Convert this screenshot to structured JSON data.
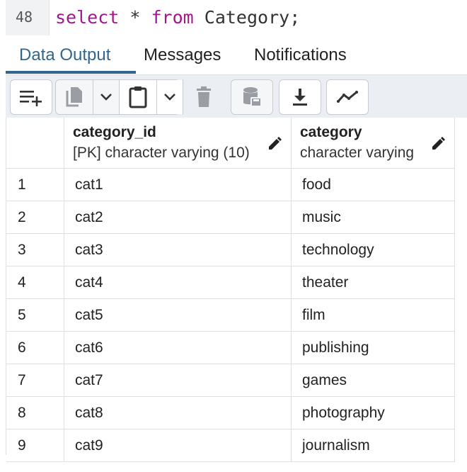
{
  "editor": {
    "line_number": "48",
    "keyword_select": "select",
    "star": "*",
    "keyword_from": "from",
    "table_name": "Category;"
  },
  "tabs": [
    {
      "label": "Data Output",
      "active": true
    },
    {
      "label": "Messages",
      "active": false
    },
    {
      "label": "Notifications",
      "active": false
    }
  ],
  "toolbar": {
    "buttons": [
      "add-row-icon",
      "copy-icon",
      "chevron-down-icon",
      "paste-icon",
      "chevron-down-icon",
      "delete-icon",
      "save-data-icon",
      "download-icon",
      "graph-visualiser-icon"
    ]
  },
  "grid": {
    "columns": [
      {
        "name": "category_id",
        "type": "[PK] character varying (10)"
      },
      {
        "name": "category",
        "type": "character varying"
      }
    ],
    "rows": [
      {
        "n": "1",
        "category_id": "cat1",
        "category": "food"
      },
      {
        "n": "2",
        "category_id": "cat2",
        "category": "music"
      },
      {
        "n": "3",
        "category_id": "cat3",
        "category": "technology"
      },
      {
        "n": "4",
        "category_id": "cat4",
        "category": "theater"
      },
      {
        "n": "5",
        "category_id": "cat5",
        "category": "film"
      },
      {
        "n": "6",
        "category_id": "cat6",
        "category": "publishing"
      },
      {
        "n": "7",
        "category_id": "cat7",
        "category": "games"
      },
      {
        "n": "8",
        "category_id": "cat8",
        "category": "photography"
      },
      {
        "n": "9",
        "category_id": "cat9",
        "category": "journalism"
      }
    ]
  },
  "colors": {
    "keyword": "#a3178a",
    "accent": "#326690"
  }
}
